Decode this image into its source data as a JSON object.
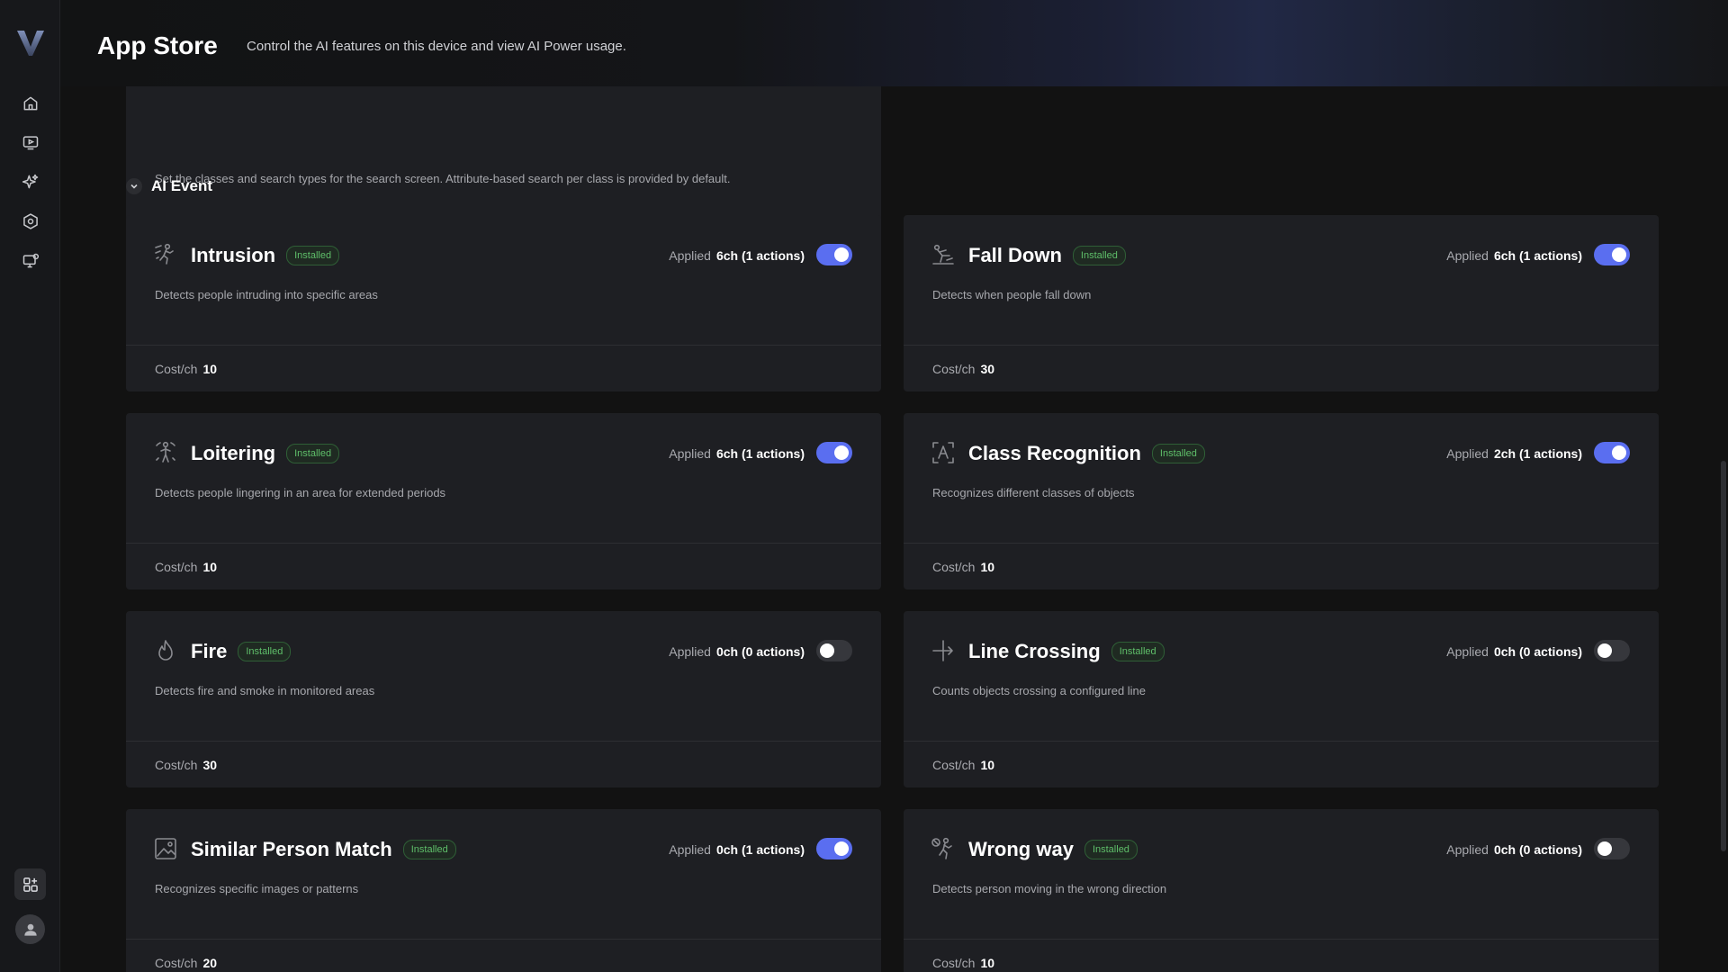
{
  "header": {
    "title": "App Store",
    "subtitle": "Control the AI features on this device and view AI Power usage."
  },
  "top_card": {
    "description": "Set the classes and search types for the search screen. Attribute-based search per class is provided by default."
  },
  "section": {
    "title": "AI Event"
  },
  "labels": {
    "applied": "Applied",
    "cost": "Cost/ch",
    "installed": "Installed"
  },
  "apps": [
    {
      "title": "Intrusion",
      "badge": "Installed",
      "applied": "6ch (1 actions)",
      "enabled": true,
      "description": "Detects people intruding into specific areas",
      "cost": "10",
      "icon": "intrusion-icon"
    },
    {
      "title": "Fall Down",
      "badge": "Installed",
      "applied": "6ch (1 actions)",
      "enabled": true,
      "description": "Detects when people fall down",
      "cost": "30",
      "icon": "fall-down-icon"
    },
    {
      "title": "Loitering",
      "badge": "Installed",
      "applied": "6ch (1 actions)",
      "enabled": true,
      "description": "Detects people lingering in an area for extended periods",
      "cost": "10",
      "icon": "loitering-icon"
    },
    {
      "title": "Class Recognition",
      "badge": "Installed",
      "applied": "2ch (1 actions)",
      "enabled": true,
      "description": "Recognizes different classes of objects",
      "cost": "10",
      "icon": "class-recognition-icon"
    },
    {
      "title": "Fire",
      "badge": "Installed",
      "applied": "0ch (0 actions)",
      "enabled": false,
      "description": "Detects fire and smoke in monitored areas",
      "cost": "30",
      "icon": "fire-icon"
    },
    {
      "title": "Line Crossing",
      "badge": "Installed",
      "applied": "0ch (0 actions)",
      "enabled": false,
      "description": "Counts objects crossing a configured line",
      "cost": "10",
      "icon": "line-crossing-icon"
    },
    {
      "title": "Similar Person Match",
      "badge": "Installed",
      "applied": "0ch (1 actions)",
      "enabled": true,
      "description": "Recognizes specific images or patterns",
      "cost": "20",
      "icon": "image-match-icon"
    },
    {
      "title": "Wrong way",
      "badge": "Installed",
      "applied": "0ch (0 actions)",
      "enabled": false,
      "description": "Detects person moving in the wrong direction",
      "cost": "10",
      "icon": "wrong-way-icon"
    }
  ],
  "colors": {
    "accent": "#5a6ef0",
    "installed_badge": "#5fbf6a",
    "card_bg": "#1e1f23",
    "page_bg": "#121212"
  }
}
